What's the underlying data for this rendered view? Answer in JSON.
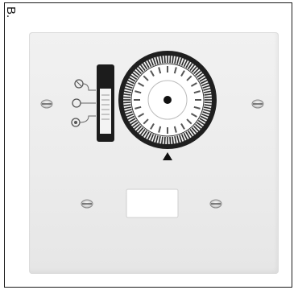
{
  "figure_label": "B.",
  "icons": {
    "mounting_screws": "screw-icon",
    "pointer": "triangle-pointer-icon",
    "program_indicators": "circle-indicator-icon"
  }
}
